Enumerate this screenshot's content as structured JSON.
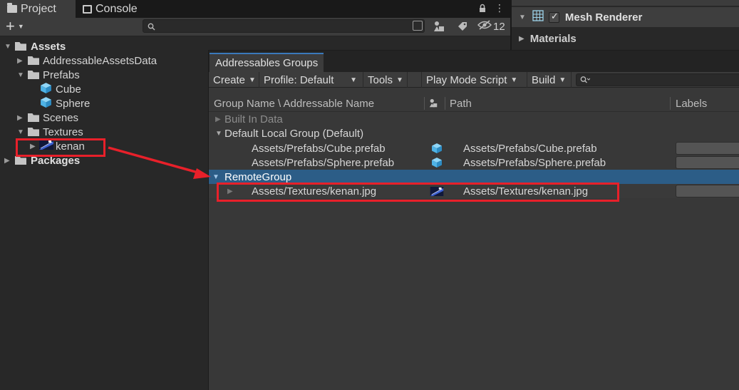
{
  "project_panel": {
    "tabs": [
      {
        "label": "Project",
        "icon": "folder-icon"
      },
      {
        "label": "Console",
        "icon": "console-icon"
      }
    ],
    "add_button": "+",
    "hidden_count": "12",
    "tree": {
      "assets": "Assets",
      "addressable_assets_data": "AddressableAssetsData",
      "prefabs": "Prefabs",
      "cube": "Cube",
      "sphere": "Sphere",
      "scenes": "Scenes",
      "textures": "Textures",
      "kenan": "kenan",
      "packages": "Packages"
    }
  },
  "inspector": {
    "mesh_renderer": "Mesh Renderer",
    "materials": "Materials"
  },
  "addressables": {
    "window_title": "Addressables Groups",
    "toolbar": {
      "create": "Create",
      "profile": "Profile: Default",
      "tools": "Tools",
      "play_mode_script": "Play Mode Script",
      "build": "Build"
    },
    "columns": {
      "name": "Group Name \\ Addressable Name",
      "path": "Path",
      "labels": "Labels"
    },
    "groups": [
      {
        "name": "Built In Data",
        "entries": []
      },
      {
        "name": "Default Local Group (Default)",
        "entries": [
          {
            "address": "Assets/Prefabs/Cube.prefab",
            "path": "Assets/Prefabs/Cube.prefab",
            "icon": "prefab-cube-icon"
          },
          {
            "address": "Assets/Prefabs/Sphere.prefab",
            "path": "Assets/Prefabs/Sphere.prefab",
            "icon": "prefab-cube-icon"
          }
        ]
      },
      {
        "name": "RemoteGroup",
        "selected": true,
        "entries": [
          {
            "address": "Assets/Textures/kenan.jpg",
            "path": "Assets/Textures/kenan.jpg",
            "icon": "texture-thumbnail-icon"
          }
        ]
      }
    ]
  },
  "colors": {
    "selection": "#2c5d87",
    "annotation_red": "#e8202a",
    "prefab_blue": "#4fb3e6"
  }
}
